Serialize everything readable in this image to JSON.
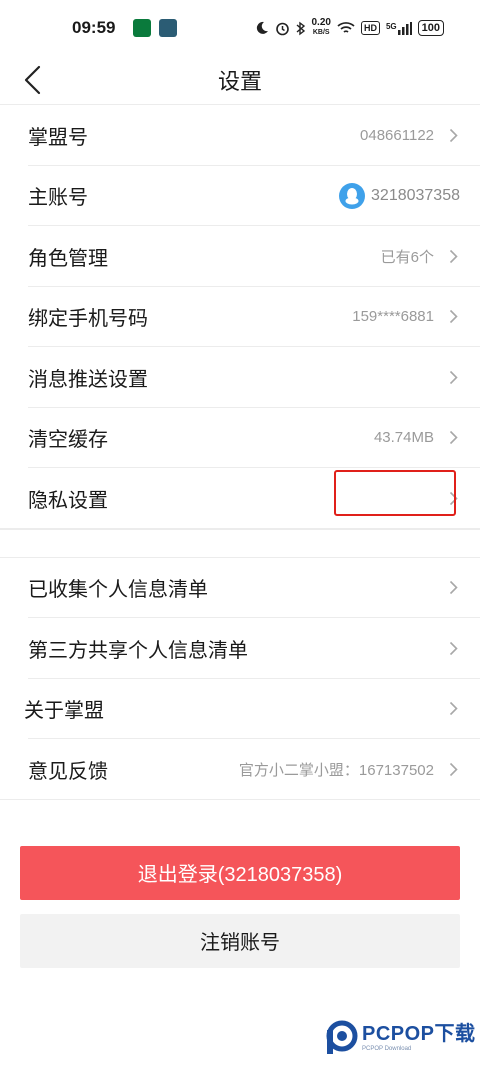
{
  "status": {
    "time": "09:59",
    "speed_value": "0.20",
    "speed_unit": "KB/S",
    "hd": "HD",
    "network": "5G",
    "battery": "100"
  },
  "nav": {
    "title": "设置"
  },
  "group1": [
    {
      "label": "掌盟号",
      "value": "048661122"
    },
    {
      "label": "主账号",
      "value": "3218037358"
    },
    {
      "label": "角色管理",
      "value": "已有6个"
    },
    {
      "label": "绑定手机号码",
      "value": "159****6881"
    },
    {
      "label": "消息推送设置",
      "value": ""
    },
    {
      "label": "清空缓存",
      "value": "43.74MB"
    },
    {
      "label": "隐私设置",
      "value": ""
    }
  ],
  "group2": [
    {
      "label": "已收集个人信息清单",
      "value": ""
    },
    {
      "label": "第三方共享个人信息清单",
      "value": ""
    },
    {
      "label": "关于掌盟",
      "value": ""
    },
    {
      "label": "意见反馈",
      "value": "官方小二掌小盟：167137502"
    }
  ],
  "buttons": {
    "logout": "退出登录(3218037358)",
    "cancel_account": "注销账号"
  },
  "watermark": {
    "main": "PCPOP下载",
    "sub": "PCPOP Download"
  },
  "colors": {
    "logout_bg": "#f5555a",
    "highlight": "#e0201a",
    "qq_blue": "#3fa1ea"
  }
}
